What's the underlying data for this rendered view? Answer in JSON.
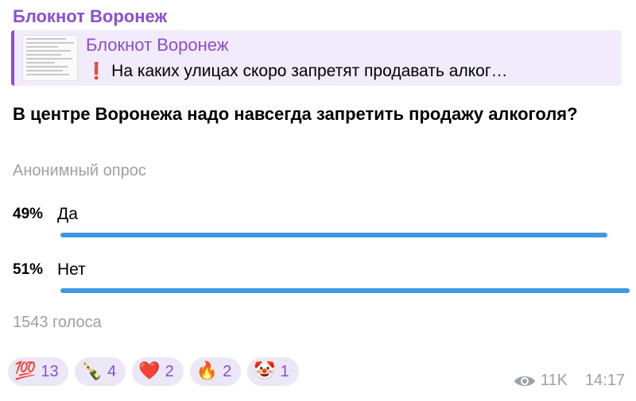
{
  "channel": {
    "name": "Блокнот Воронеж"
  },
  "reply": {
    "title": "Блокнот Воронеж",
    "icon": "exclamation-icon",
    "text": "На каких улицах скоро запретят продавать алког…"
  },
  "poll": {
    "question": "В центре Воронежа надо навсегда запретить продажу алкоголя?",
    "type": "Анонимный опрос",
    "options": [
      {
        "percent": "49%",
        "label": "Да",
        "fraction": 0.49
      },
      {
        "percent": "51%",
        "label": "Нет",
        "fraction": 0.51
      }
    ],
    "votes": "1543 голоса"
  },
  "reactions": [
    {
      "emoji": "💯",
      "icon": "hundred-points-icon",
      "count": "13"
    },
    {
      "emoji": "🍾",
      "icon": "champagne-bottle-icon",
      "count": "4"
    },
    {
      "emoji": "❤️",
      "icon": "red-heart-icon",
      "count": "2"
    },
    {
      "emoji": "🔥",
      "icon": "fire-icon",
      "count": "2"
    },
    {
      "emoji": "🤡",
      "icon": "clown-face-icon",
      "count": "1"
    }
  ],
  "meta": {
    "views": "11K",
    "time": "14:17"
  },
  "colors": {
    "accent": "#8c4fd1",
    "bar": "#3d9ae1",
    "muted": "#9aa1a8"
  }
}
